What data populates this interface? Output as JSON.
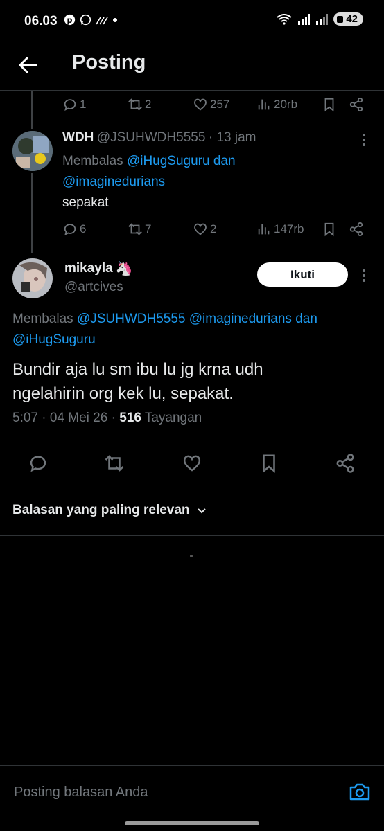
{
  "status_bar": {
    "time": "06.03",
    "battery": "42",
    "icons": [
      "pinterest-icon",
      "whatsapp-icon",
      "signal-lines-icon",
      "dot-icon",
      "wifi-icon",
      "cellular-signal-icon",
      "cellular-signal-2-icon"
    ]
  },
  "header": {
    "title": "Posting",
    "back_icon": "arrow-left-icon"
  },
  "tweet1_actions": {
    "replies": "1",
    "retweets": "2",
    "likes": "257",
    "views": "20rb"
  },
  "reply1": {
    "name": "WDH",
    "handle": "@JSUHWDH5555",
    "time": "· 13 jam",
    "replying_prefix": "Membalas",
    "replying_to1": "@iHugSuguru",
    "replying_and": "dan",
    "replying_to2": "@imaginedurians",
    "text": "sepakat",
    "actions": {
      "replies": "6",
      "retweets": "7",
      "likes": "2",
      "views": "147rb"
    }
  },
  "main_tweet": {
    "name": "mikayla",
    "name_emoji": "🦄",
    "handle": "@artcives",
    "follow_label": "Ikuti",
    "replying_prefix": "Membalas",
    "replying_to1": "@JSUHWDH5555",
    "replying_to2": "@imaginedurians",
    "replying_and": "dan",
    "replying_to3": "@iHugSuguru",
    "text_line1": "Bundir aja lu sm ibu lu jg krna udh",
    "text_line2": "ngelahirin org kek lu, sepakat.",
    "meta_time": "5:07 · 04 Mei 26 ·",
    "meta_views": "516",
    "meta_views_label": "Tayangan"
  },
  "sort": {
    "label": "Balasan yang paling relevan"
  },
  "reply_bar": {
    "placeholder": "Posting balasan Anda"
  },
  "colors": {
    "background": "#000000",
    "text": "#e7e9ea",
    "muted": "#71767b",
    "link": "#1d9bf0",
    "divider": "#2f3336"
  }
}
